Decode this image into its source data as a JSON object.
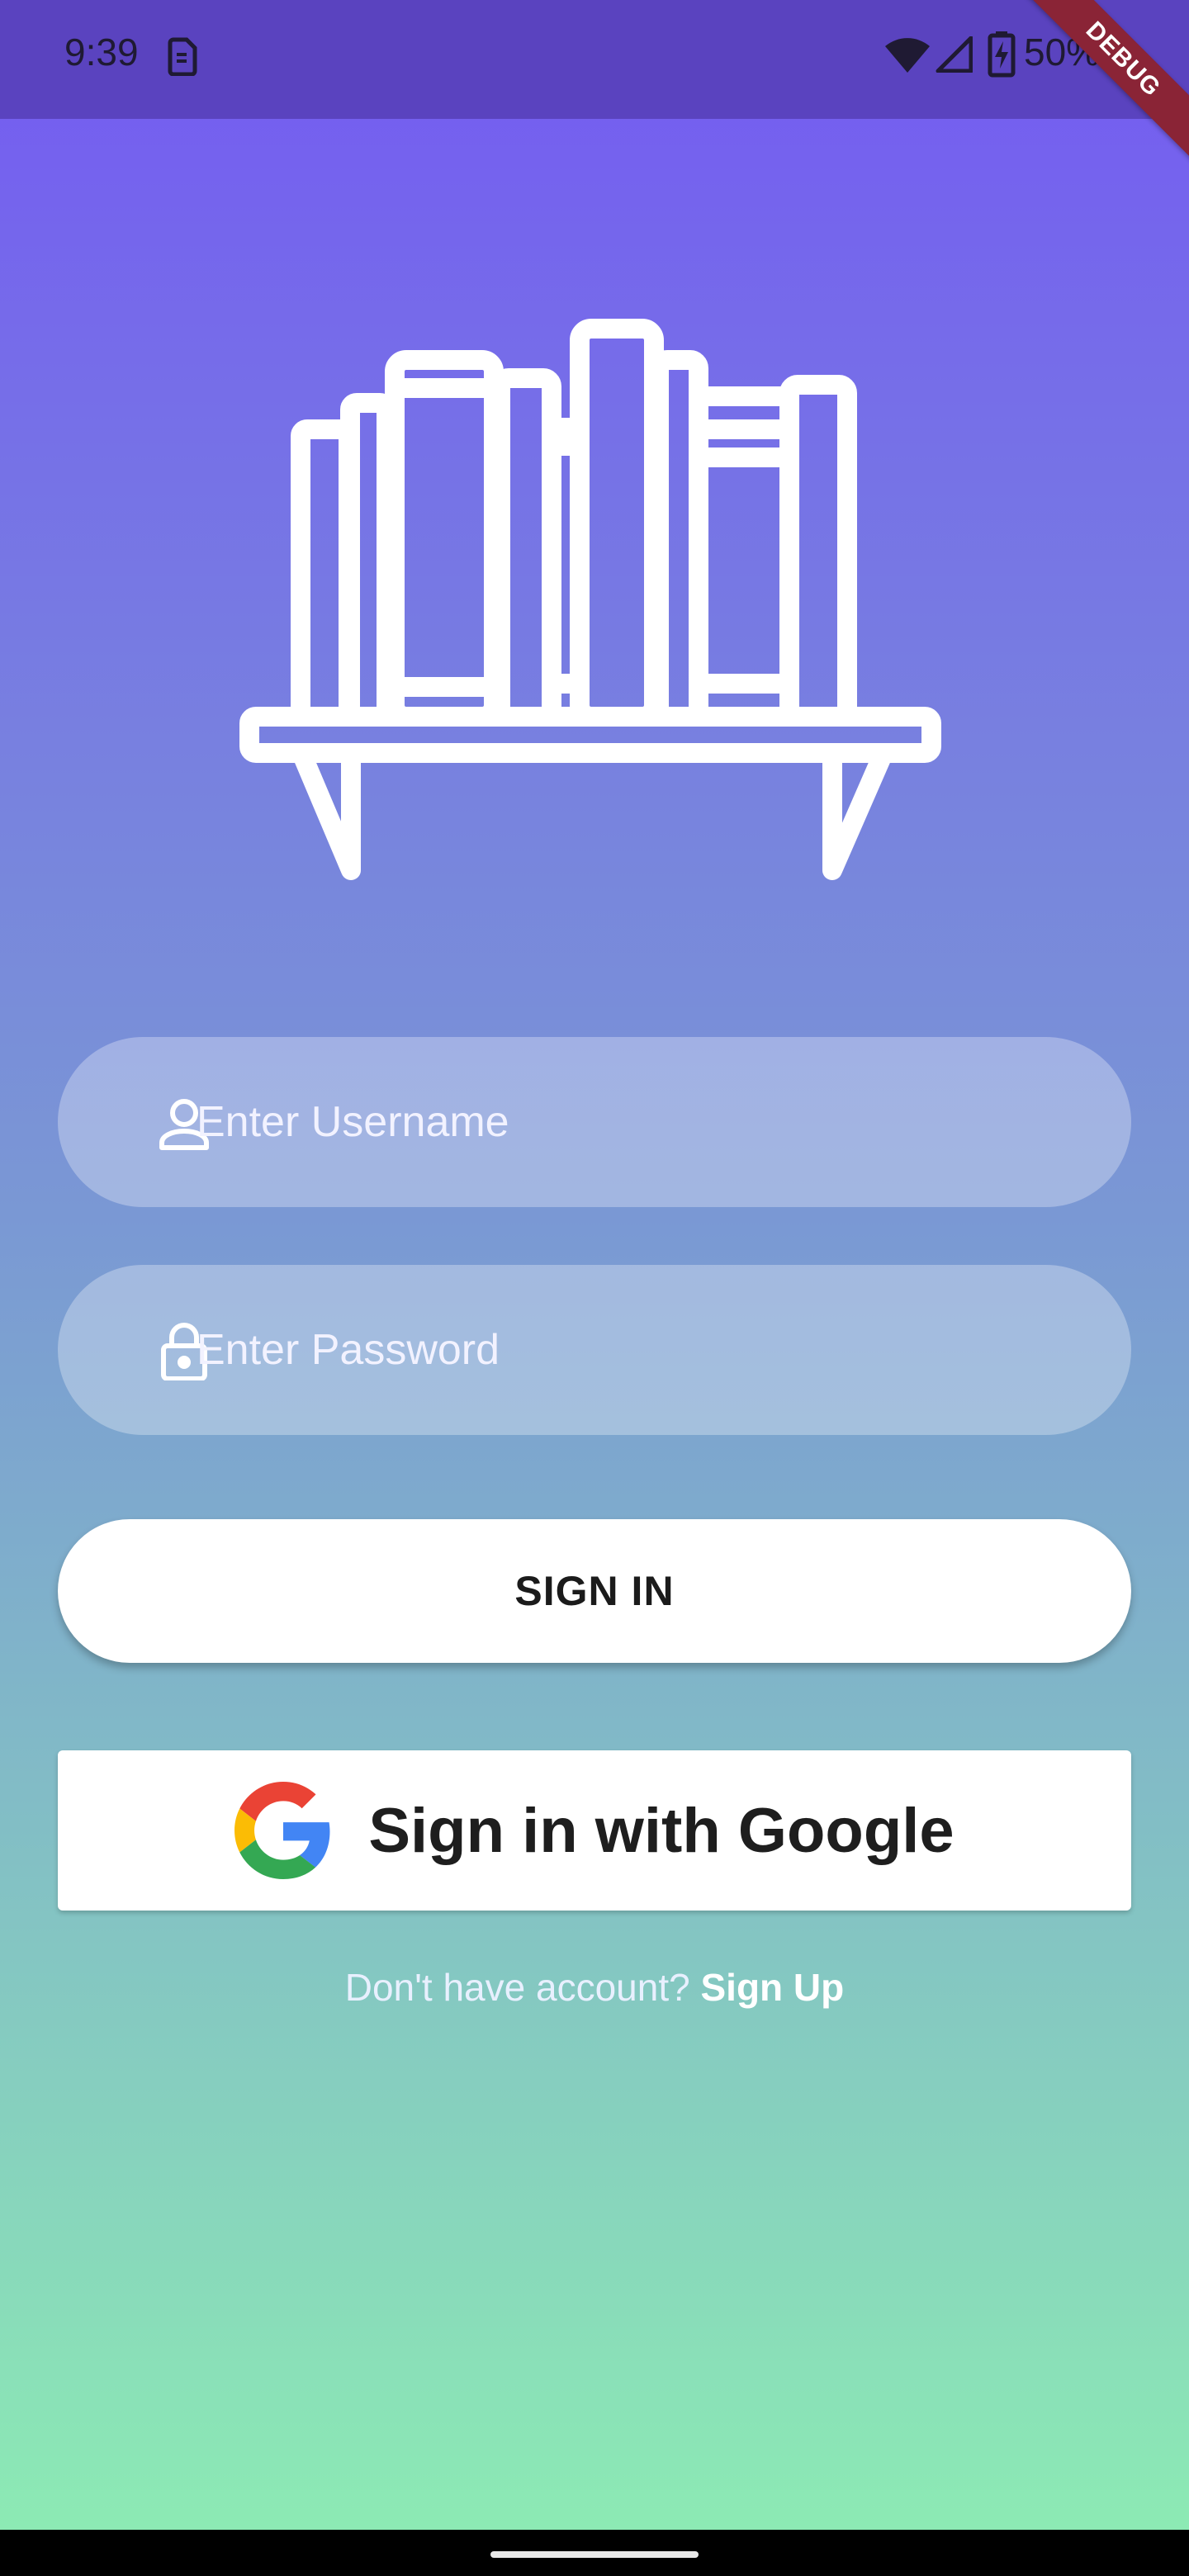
{
  "status_bar": {
    "time": "9:39",
    "battery_percent": "50%",
    "debug_label": "DEBUG",
    "icons": [
      "sim-card-icon",
      "wifi-icon",
      "signal-icon",
      "battery-charging-icon"
    ]
  },
  "logo": {
    "icon": "bookshelf-icon"
  },
  "login_form": {
    "username_placeholder": "Enter Username",
    "username_icon": "person-icon",
    "password_placeholder": "Enter Password",
    "password_icon": "lock-icon",
    "sign_in_label": "SIGN IN",
    "google_label": "Sign in with Google",
    "google_icon": "google-g-icon"
  },
  "signup": {
    "prompt": "Don't have account? ",
    "link": "Sign Up"
  },
  "colors": {
    "gradient_top": "#745af2",
    "gradient_bottom": "#8ceab4",
    "status_bar": "#5a43bf",
    "debug_ribbon": "#8a2436"
  }
}
